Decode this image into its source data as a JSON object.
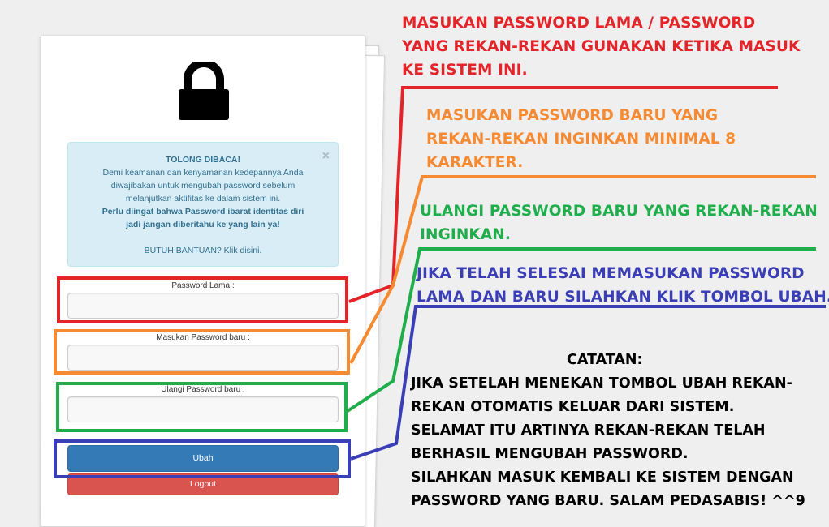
{
  "alert": {
    "title": "TOLONG DIBACA!",
    "close_symbol": "×",
    "body_lines": [
      "Demi keamanan dan kenyamanan kedepannya Anda",
      "diwajibakan untuk mengubah password sebelum",
      "melanjutkan aktifitas ke dalam sistem ini."
    ],
    "bold_lines": [
      "Perlu diingat bahwa Password ibarat identitas diri",
      "jadi jangan diberitahu ke yang lain ya!"
    ],
    "help_text": "BUTUH BANTUAN? Klik disini."
  },
  "form": {
    "old_password_label": "Password Lama :",
    "new_password_label": "Masukan Password baru :",
    "repeat_password_label": "Ulangi Password baru :",
    "old_password_value": "",
    "new_password_value": "",
    "repeat_password_value": ""
  },
  "buttons": {
    "submit_label": "Ubah",
    "logout_label": "Logout"
  },
  "annotations": {
    "red": {
      "color": "#e32428",
      "lines": [
        "MASUKAN PASSWORD LAMA / PASSWORD",
        "YANG REKAN-REKAN GUNAKAN KETIKA MASUK",
        "KE SISTEM INI."
      ]
    },
    "orange": {
      "color": "#f58a33",
      "lines": [
        "MASUKAN PASSWORD BARU YANG",
        "REKAN-REKAN INGINKAN MINIMAL 8",
        "KARAKTER."
      ]
    },
    "green": {
      "color": "#1fae4b",
      "lines": [
        "ULANGI PASSWORD BARU YANG REKAN-REKAN",
        "INGINKAN."
      ]
    },
    "blue": {
      "color": "#3b3fb6",
      "lines": [
        "JIKA TELAH SELESAI MEMASUKAN PASSWORD",
        "LAMA DAN BARU SILAHKAN KLIK TOMBOL UBAH."
      ]
    }
  },
  "note": {
    "title": "CATATAN:",
    "lines": [
      "JIKA SETELAH MENEKAN TOMBOL UBAH REKAN-",
      "REKAN OTOMATIS KELUAR DARI SISTEM.",
      "SELAMAT ITU ARTINYA REKAN-REKAN TELAH",
      "BERHASIL MENGUBAH PASSWORD.",
      "SILAHKAN MASUK KEMBALI KE SISTEM DENGAN",
      "PASSWORD YANG BARU.  SALAM PEDASABIS! ^^9"
    ]
  },
  "icons": {
    "lock": "lock-icon",
    "close": "close-icon"
  },
  "colors": {
    "alert_bg": "#d9edf7",
    "alert_text": "#31708f",
    "primary": "#337ab7",
    "danger": "#d9534f"
  }
}
